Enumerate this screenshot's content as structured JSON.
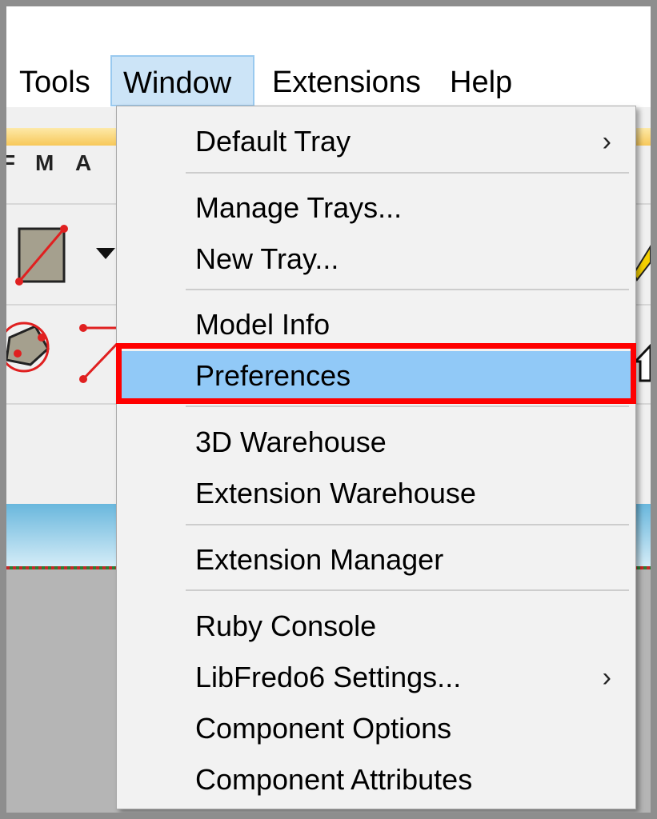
{
  "menubar": {
    "items": [
      "Tools",
      "Window",
      "Extensions",
      "Help"
    ]
  },
  "toolbar": {
    "letters": [
      "F",
      "M",
      "A"
    ]
  },
  "window_menu": {
    "items": [
      {
        "label": "Default Tray",
        "submenu": true
      },
      {
        "label": "Manage Trays...",
        "submenu": false
      },
      {
        "label": "New Tray...",
        "submenu": false
      },
      {
        "label": "Model Info",
        "submenu": false
      },
      {
        "label": "Preferences",
        "submenu": false,
        "highlighted": true
      },
      {
        "label": "3D Warehouse",
        "submenu": false
      },
      {
        "label": "Extension Warehouse",
        "submenu": false
      },
      {
        "label": "Extension Manager",
        "submenu": false
      },
      {
        "label": "Ruby Console",
        "submenu": false
      },
      {
        "label": "LibFredo6 Settings...",
        "submenu": true
      },
      {
        "label": "Component Options",
        "submenu": false
      },
      {
        "label": "Component Attributes",
        "submenu": false
      }
    ],
    "submenu_glyph": "›"
  },
  "colors": {
    "highlight": "#91c9f7",
    "callout_border": "#ff0000",
    "menu_open": "#cce4f7"
  }
}
